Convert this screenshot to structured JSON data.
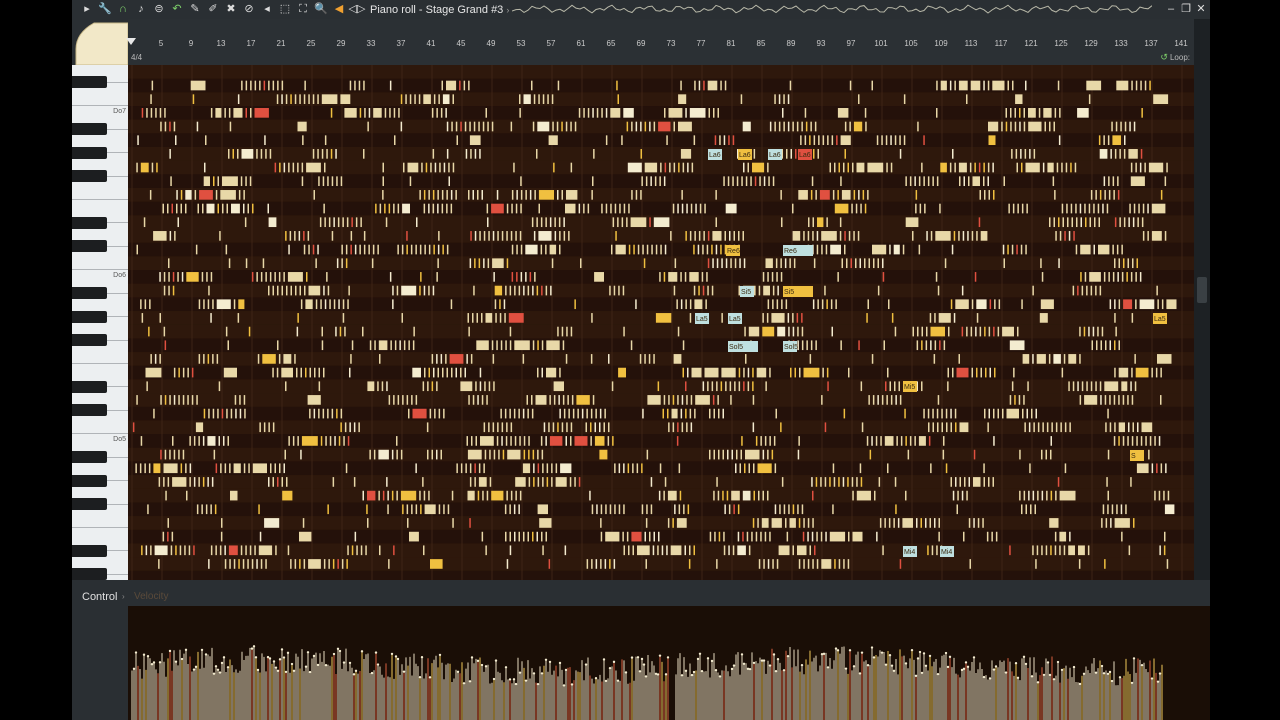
{
  "window": {
    "title": "Piano roll - Stage Grand #3",
    "title_arrow": "›",
    "buttons": {
      "minimize": "–",
      "restore": "❐",
      "close": "✕"
    }
  },
  "toolbar": {
    "icons": [
      {
        "name": "play-arrow-icon",
        "glyph": "▸"
      },
      {
        "name": "wrench-icon",
        "glyph": "🔧"
      },
      {
        "name": "magnet-icon",
        "glyph": "∩",
        "accent": "green"
      },
      {
        "name": "note-icon",
        "glyph": "♪"
      },
      {
        "name": "tools-circle-icon",
        "glyph": "⊜"
      },
      {
        "name": "undo-icon",
        "glyph": "↶",
        "accent": "green"
      },
      {
        "name": "pencil-icon",
        "glyph": "✎"
      },
      {
        "name": "brush-icon",
        "glyph": "✐"
      },
      {
        "name": "delete-icon",
        "glyph": "✖"
      },
      {
        "name": "mute-icon",
        "glyph": "⊘"
      },
      {
        "name": "slice-icon",
        "glyph": "◂"
      },
      {
        "name": "select-icon",
        "glyph": "⬚"
      },
      {
        "name": "zoom-rect-icon",
        "glyph": "⛶"
      },
      {
        "name": "zoom-icon",
        "glyph": "🔍"
      },
      {
        "name": "speaker-icon",
        "glyph": "◀",
        "accent": "orange"
      },
      {
        "name": "preview-icon",
        "glyph": "◁▷"
      }
    ]
  },
  "ruler": {
    "time_signature": "4/4",
    "loop_label": "Loop:",
    "bars": [
      "5",
      "9",
      "13",
      "17",
      "21",
      "25",
      "29",
      "33",
      "37",
      "41",
      "45",
      "49",
      "53",
      "57",
      "61",
      "65",
      "69",
      "73",
      "77",
      "81",
      "85",
      "89",
      "93",
      "97",
      "101",
      "105",
      "109",
      "113",
      "117",
      "121",
      "125",
      "129",
      "133",
      "137",
      "141"
    ]
  },
  "keyboard": {
    "octave_labels": [
      "Do7",
      "Do6",
      "Do5"
    ]
  },
  "notes": {
    "labels": [
      "La6",
      "La6",
      "La6",
      "La6",
      "Re6",
      "Re6",
      "Si5",
      "Si5",
      "La5",
      "La5",
      "La5",
      "Sol5",
      "Sol5",
      "Mi5",
      "Mi4",
      "Mi4",
      "S"
    ]
  },
  "control": {
    "label": "Control",
    "arrow": "›",
    "parameter": "Velocity"
  },
  "colors": {
    "note_default": "#e8d8a8",
    "note_gold": "#f0c040",
    "note_pale": "#f4ecd0",
    "note_red": "#e05040",
    "grid_bg": "#2a1508",
    "accent_green": "#7fd36b"
  }
}
